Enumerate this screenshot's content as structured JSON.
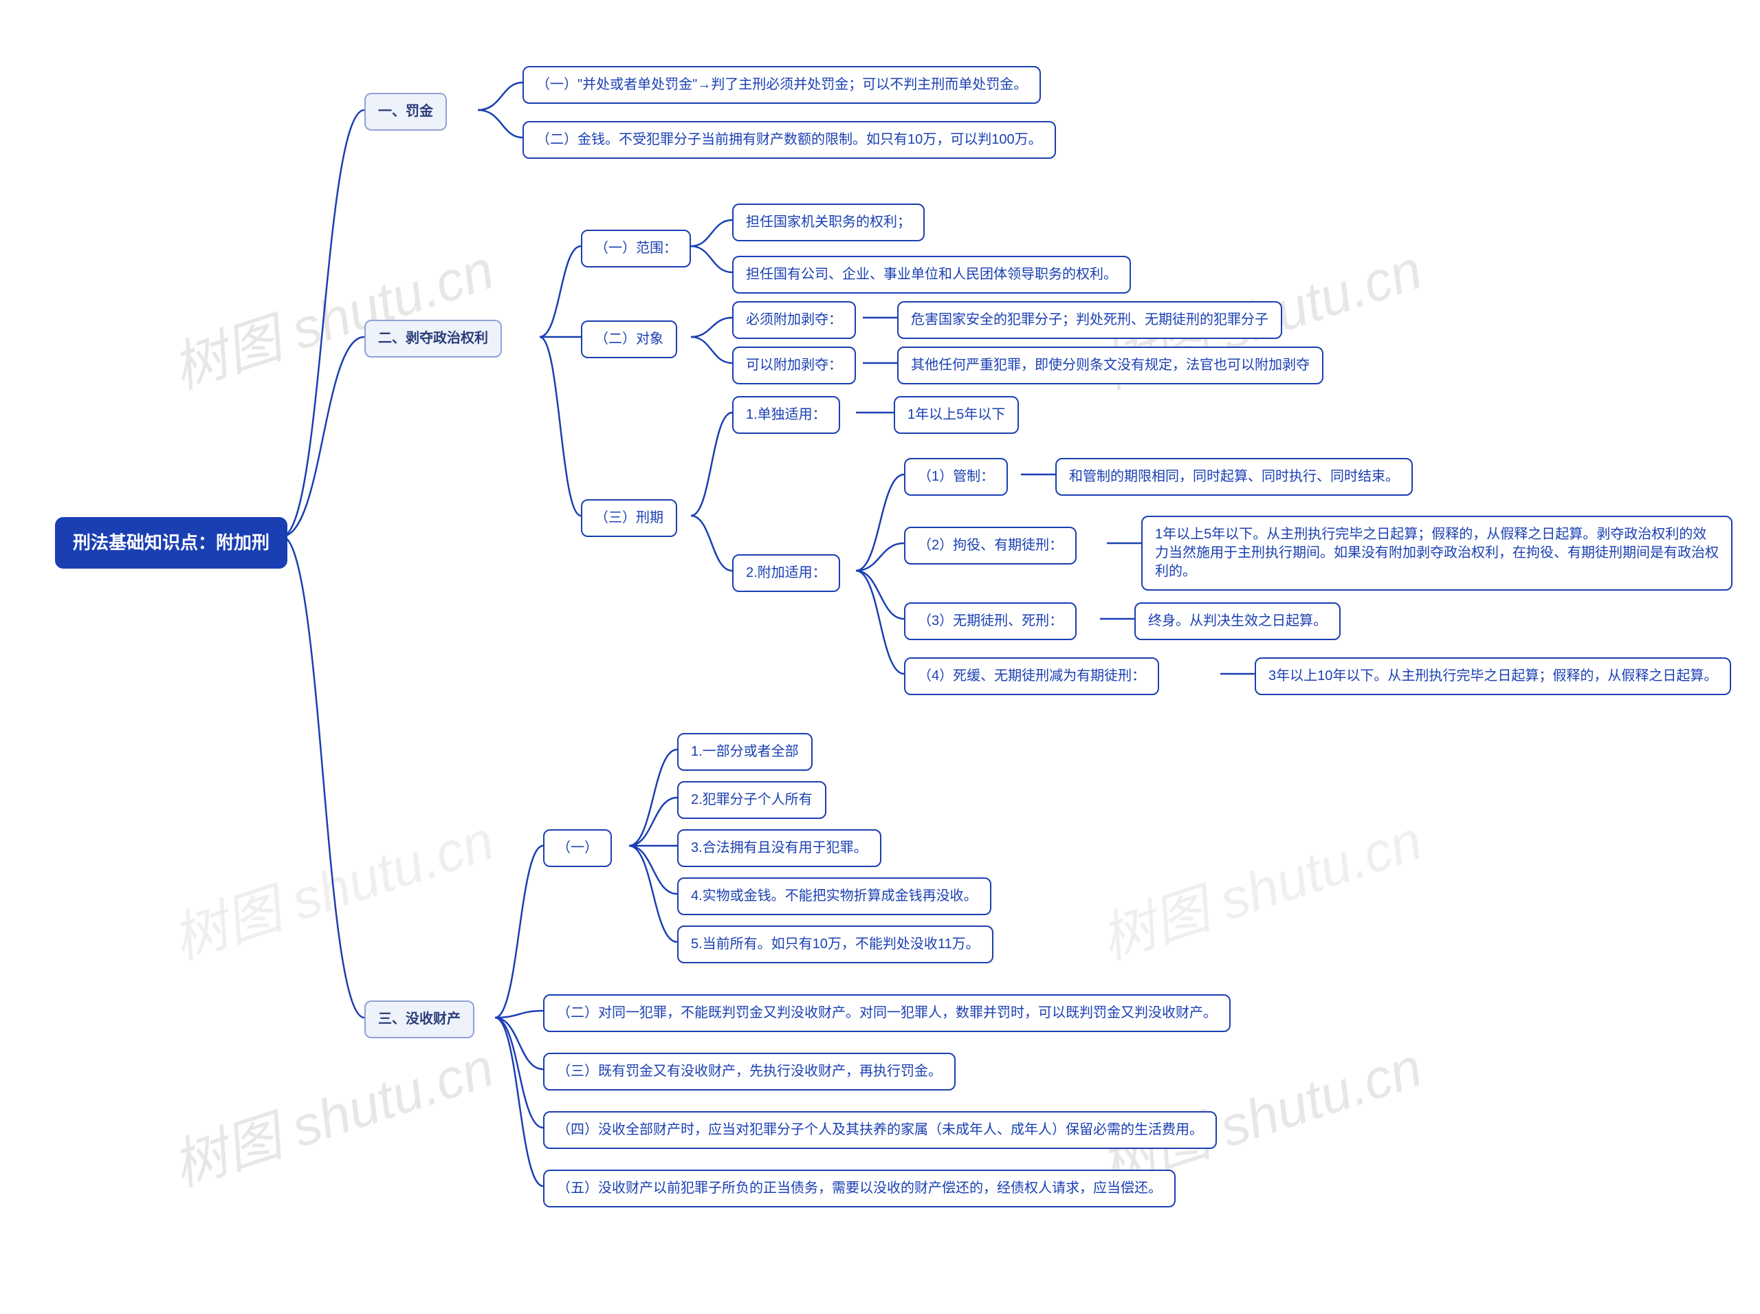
{
  "_comment": "Mindmap recreation. All visible text stored here; template binds via data-bind.",
  "watermark": "树图 shutu.cn",
  "root": "刑法基础知识点：附加刑",
  "b1": {
    "title": "一、罚金",
    "c1": "（一）\"并处或者单处罚金\"→判了主刑必须并处罚金；可以不判主刑而单处罚金。",
    "c2": "（二）金钱。不受犯罪分子当前拥有财产数额的限制。如只有10万，可以判100万。"
  },
  "b2": {
    "title": "二、剥夺政治权利",
    "s1": {
      "title": "（一）范围：",
      "a": "担任国家机关职务的权利；",
      "b": "担任国有公司、企业、事业单位和人民团体领导职务的权利。"
    },
    "s2": {
      "title": "（二）对象",
      "a": {
        "k": "必须附加剥夺：",
        "v": "危害国家安全的犯罪分子；判处死刑、无期徒刑的犯罪分子"
      },
      "b": {
        "k": "可以附加剥夺：",
        "v": "其他任何严重犯罪，即使分则条文没有规定，法官也可以附加剥夺"
      }
    },
    "s3": {
      "title": "（三）刑期",
      "a": {
        "k": "1.单独适用：",
        "v": "1年以上5年以下"
      },
      "b": {
        "k": "2.附加适用：",
        "c1": {
          "k": "（1）管制：",
          "v": "和管制的期限相同，同时起算、同时执行、同时结束。"
        },
        "c2": {
          "k": "（2）拘役、有期徒刑：",
          "v": "1年以上5年以下。从主刑执行完毕之日起算；假释的，从假释之日起算。剥夺政治权利的效力当然施用于主刑执行期间。如果没有附加剥夺政治权利，在拘役、有期徒刑期间是有政治权利的。"
        },
        "c3": {
          "k": "（3）无期徒刑、死刑：",
          "v": "终身。从判决生效之日起算。"
        },
        "c4": {
          "k": "（4）死缓、无期徒刑减为有期徒刑：",
          "v": "3年以上10年以下。从主刑执行完毕之日起算；假释的，从假释之日起算。"
        }
      }
    }
  },
  "b3": {
    "title": "三、没收财产",
    "s1": {
      "title": "（一）",
      "a": "1.一部分或者全部",
      "b": "2.犯罪分子个人所有",
      "c": "3.合法拥有且没有用于犯罪。",
      "d": "4.实物或金钱。不能把实物折算成金钱再没收。",
      "e": "5.当前所有。如只有10万，不能判处没收11万。"
    },
    "s2": "（二）对同一犯罪，不能既判罚金又判没收财产。对同一犯罪人，数罪并罚时，可以既判罚金又判没收财产。",
    "s3": "（三）既有罚金又有没收财产，先执行没收财产，再执行罚金。",
    "s4": "（四）没收全部财产时，应当对犯罪分子个人及其扶养的家属（未成年人、成年人）保留必需的生活费用。",
    "s5": "（五）没收财产以前犯罪子所负的正当债务，需要以没收的财产偿还的，经债权人请求，应当偿还。"
  }
}
